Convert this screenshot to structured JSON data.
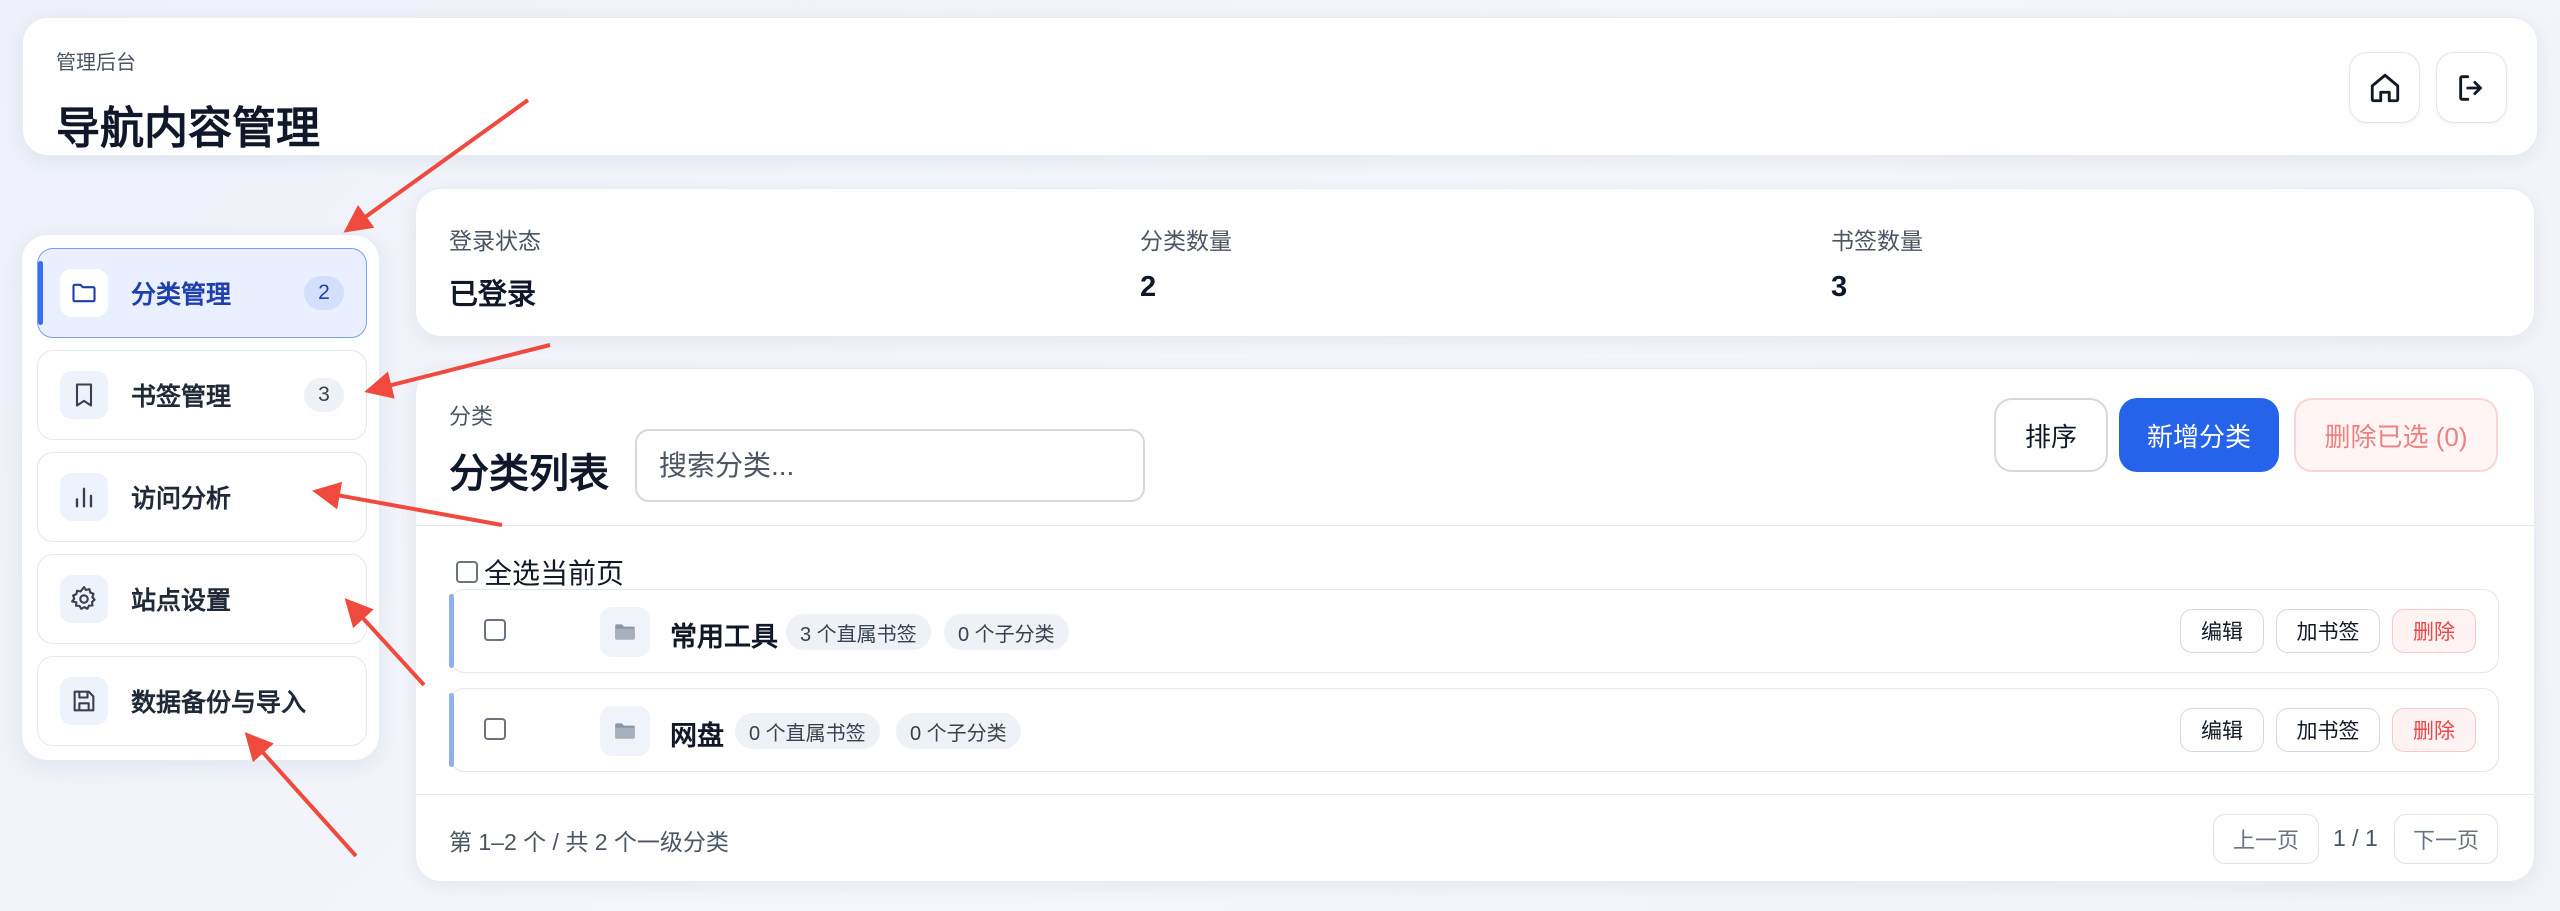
{
  "header": {
    "subtitle": "管理后台",
    "title": "导航内容管理",
    "buttons": [
      {
        "icon": "home-icon"
      },
      {
        "icon": "logout-icon"
      }
    ]
  },
  "sidebar": {
    "items": [
      {
        "label": "分类管理",
        "count": "2",
        "icon": "folder-icon",
        "active": true
      },
      {
        "label": "书签管理",
        "count": "3",
        "icon": "bookmark-icon",
        "active": false
      },
      {
        "label": "访问分析",
        "count": "",
        "icon": "bar-chart-icon",
        "active": false
      },
      {
        "label": "站点设置",
        "count": "",
        "icon": "gear-icon",
        "active": false
      },
      {
        "label": "数据备份与导入",
        "count": "",
        "icon": "save-icon",
        "active": false
      }
    ]
  },
  "stats": [
    {
      "label": "登录状态",
      "value": "已登录"
    },
    {
      "label": "分类数量",
      "value": "2"
    },
    {
      "label": "书签数量",
      "value": "3"
    }
  ],
  "list": {
    "eyebrow": "分类",
    "title": "分类列表",
    "search_placeholder": "搜索分类...",
    "sort_label": "排序",
    "add_label": "新增分类",
    "delete_selected_label": "删除已选 (0)",
    "select_all_label": "全选当前页",
    "rows": [
      {
        "name": "常用工具",
        "bookmarks": "3 个直属书签",
        "children": "0 个子分类",
        "edit": "编辑",
        "add_bookmark": "加书签",
        "delete": "删除"
      },
      {
        "name": "网盘",
        "bookmarks": "0 个直属书签",
        "children": "0 个子分类",
        "edit": "编辑",
        "add_bookmark": "加书签",
        "delete": "删除"
      }
    ],
    "footer_text": "第 1–2 个 / 共 2 个一级分类",
    "prev_label": "上一页",
    "page_info": "1 / 1",
    "next_label": "下一页"
  },
  "colors": {
    "accent": "#2563eb",
    "annotation_arrow": "#f04a3e",
    "danger": "#ef4444"
  }
}
